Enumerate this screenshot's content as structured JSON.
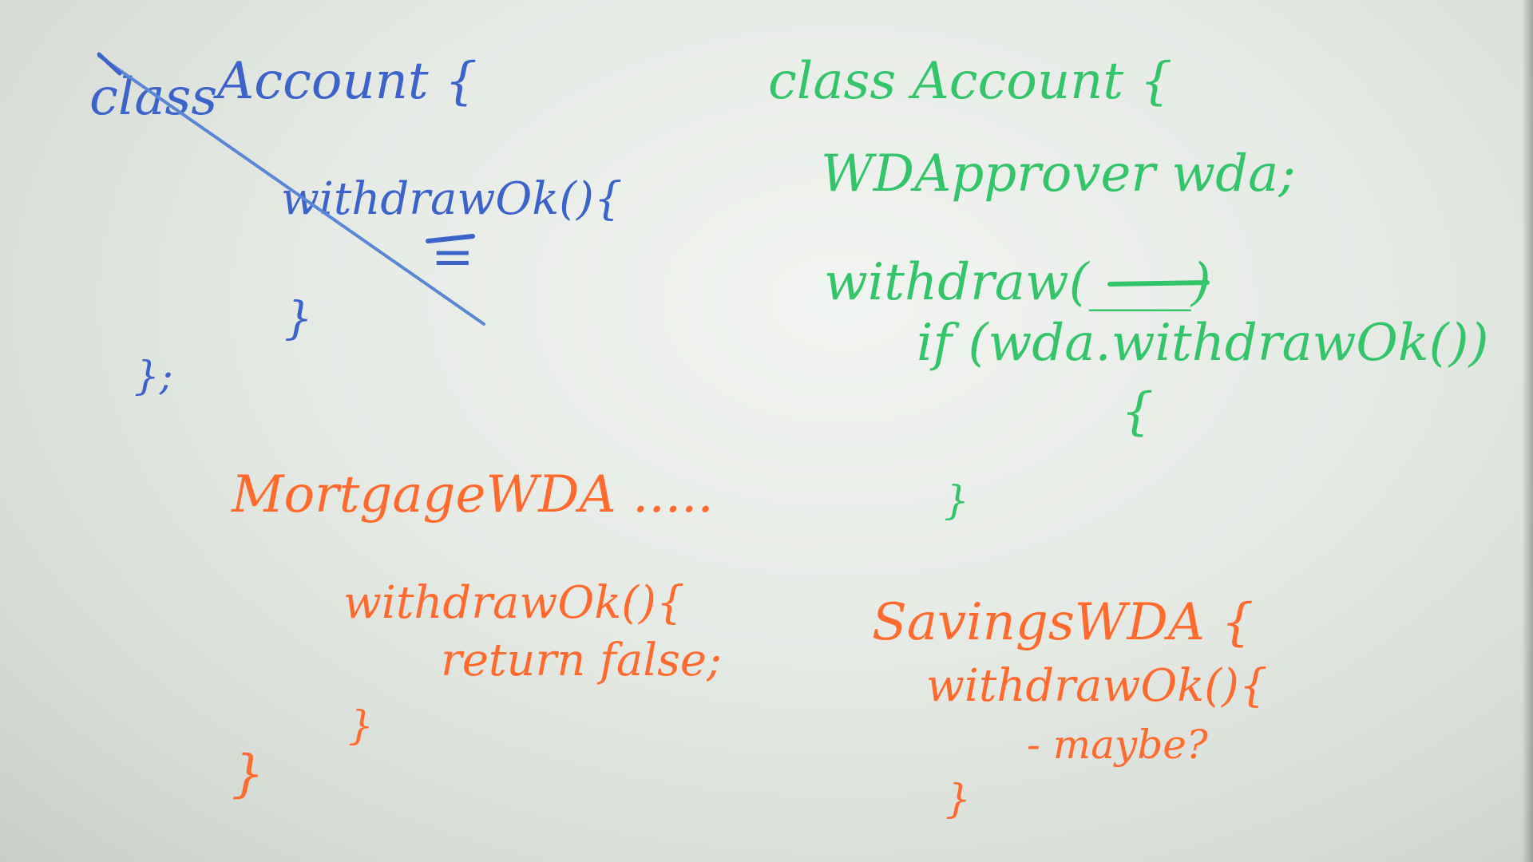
{
  "board": {
    "blue_code": {
      "line1_keyword": "class",
      "line1_name": "Account {",
      "line2": "withdrawOk(){",
      "line3": "=",
      "line4": "}",
      "line5": "};"
    },
    "green_code": {
      "line1": "class Account {",
      "line2": "WDApprover wda;",
      "line3": "withdraw(____)",
      "line4": "if (wda.withdrawOk())",
      "line5": "{",
      "line6": "}"
    },
    "orange_mortgage": {
      "line1": "MortgageWDA .....",
      "line2": "withdrawOk(){",
      "line3": "return false;",
      "line4": "}",
      "line5": "}"
    },
    "orange_savings": {
      "line1": "SavingsWDA {",
      "line2": "withdrawOk(){",
      "line3": "- maybe?",
      "line4": "}"
    }
  },
  "colors": {
    "blue_marker": "#3b63c9",
    "green_marker": "#34c46a",
    "orange_marker": "#ff6b2f",
    "board": "#e8ece7"
  }
}
